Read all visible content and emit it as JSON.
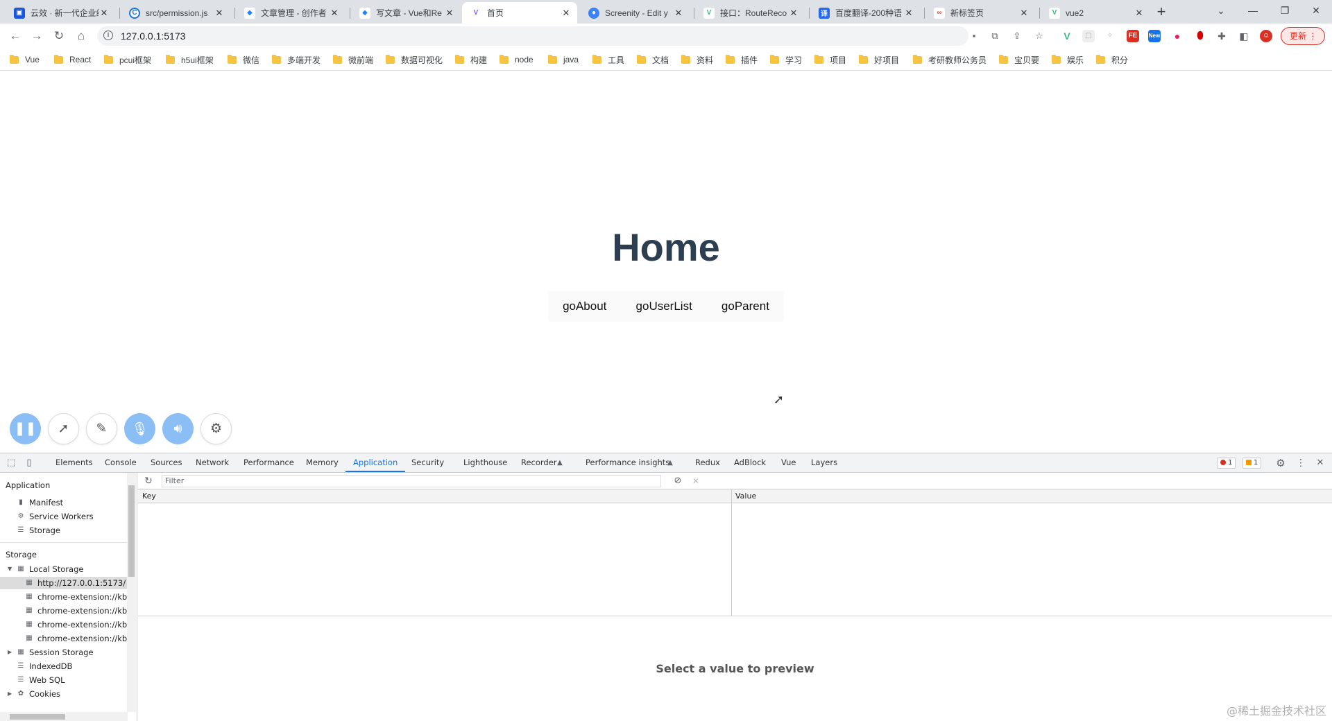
{
  "browser": {
    "tabs": [
      {
        "title": "云效 · 新一代企业级",
        "favicon": "yunxiao",
        "color": "#1a56db"
      },
      {
        "title": "src/permission.js",
        "favicon": "codeup",
        "color": "#1a73e8"
      },
      {
        "title": "文章管理 - 创作者",
        "favicon": "juejin",
        "color": "#1e80ff"
      },
      {
        "title": "写文章 - Vue和Re",
        "favicon": "juejin",
        "color": "#1e80ff"
      },
      {
        "title": "首页",
        "favicon": "vite",
        "color": "#8b5cf6",
        "active": true
      },
      {
        "title": "Screenity - Edit y",
        "favicon": "screenity",
        "color": "#3b82f6"
      },
      {
        "title": "接口：RouteReco",
        "favicon": "vue",
        "color": "#42b883"
      },
      {
        "title": "百度翻译-200种语",
        "favicon": "baidu-translate",
        "color": "#2468f2"
      },
      {
        "title": "新标签页",
        "favicon": "newtab",
        "color": "#ea4335"
      },
      {
        "title": "vue2",
        "favicon": "vue",
        "color": "#42b883"
      }
    ],
    "new_tab_icon": "plus-icon",
    "url": "127.0.0.1:5173",
    "update_label": "更新",
    "bookmarks": [
      "Vue",
      "React",
      "pcui框架",
      "h5ui框架",
      "微信",
      "多端开发",
      "微前端",
      "数据可视化",
      "构建",
      "node",
      "java",
      "工具",
      "文档",
      "资料",
      "插件",
      "学习",
      "项目",
      "好项目",
      "考研教师公务员",
      "宝贝要",
      "娱乐",
      "积分"
    ]
  },
  "page": {
    "title": "Home",
    "links": [
      "goAbout",
      "goUserList",
      "goParent"
    ]
  },
  "recorder": {
    "buttons": [
      "pause-icon",
      "cursor-icon",
      "pen-icon",
      "microphone-icon",
      "speaker-icon",
      "gear-icon"
    ]
  },
  "devtools": {
    "tabs": [
      "Elements",
      "Console",
      "Sources",
      "Network",
      "Performance",
      "Memory",
      "Application",
      "Security",
      "Lighthouse",
      "Recorder",
      "Performance insights",
      "Redux",
      "AdBlock",
      "Vue",
      "Layers"
    ],
    "active_tab": "Application",
    "error_count": "1",
    "warning_count": "1",
    "sidebar": {
      "application_header": "Application",
      "application_items": [
        "Manifest",
        "Service Workers",
        "Storage"
      ],
      "storage_header": "Storage",
      "local_storage": "Local Storage",
      "local_storage_children": [
        "http://127.0.0.1:5173/",
        "chrome-extension://kbb",
        "chrome-extension://kbb",
        "chrome-extension://kbb",
        "chrome-extension://kbb"
      ],
      "other_storage": [
        "Session Storage",
        "IndexedDB",
        "Web SQL",
        "Cookies"
      ]
    },
    "filter_placeholder": "Filter",
    "columns": {
      "key": "Key",
      "value": "Value"
    },
    "preview_message": "Select a value to preview"
  },
  "watermark": "@稀土掘金技术社区"
}
